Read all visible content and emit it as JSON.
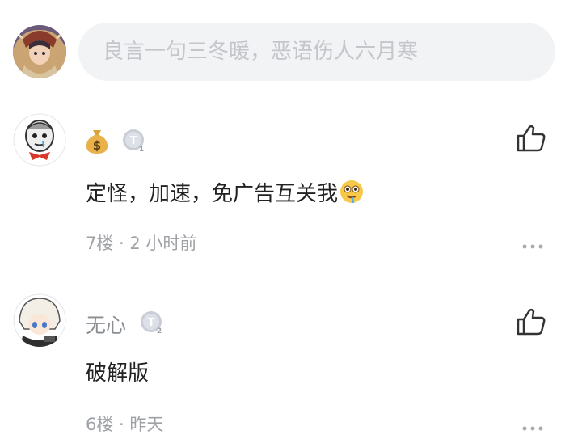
{
  "composer": {
    "placeholder": "良言一句三冬暖，恶语伤人六月寒",
    "avatar_icon": "user-avatar-anime"
  },
  "comments": [
    {
      "username": "",
      "badge_icon": "money-bag-icon",
      "level_icon": "level-T1-badge",
      "level_label": "T1",
      "text": "定怪，加速，免广告互关我",
      "emoji_icon": "drooling-face-emoji",
      "floor": "7楼",
      "separator": "·",
      "time": "2 小时前",
      "meta_text": "7楼 · 2 小时前"
    },
    {
      "username": "无心",
      "level_icon": "level-T2-badge",
      "level_label": "T2",
      "text": "破解版",
      "floor": "6楼",
      "separator": "·",
      "time": "昨天",
      "meta_text": "6楼 · 昨天"
    }
  ],
  "icons": {
    "like": "thumbs-up-icon",
    "more": "more-dots-icon"
  },
  "colors": {
    "placeholder": "#c4c6cc",
    "input_bg": "#f2f3f5",
    "text": "#222222",
    "meta": "#9ea1a6",
    "username": "#8a8d93"
  }
}
